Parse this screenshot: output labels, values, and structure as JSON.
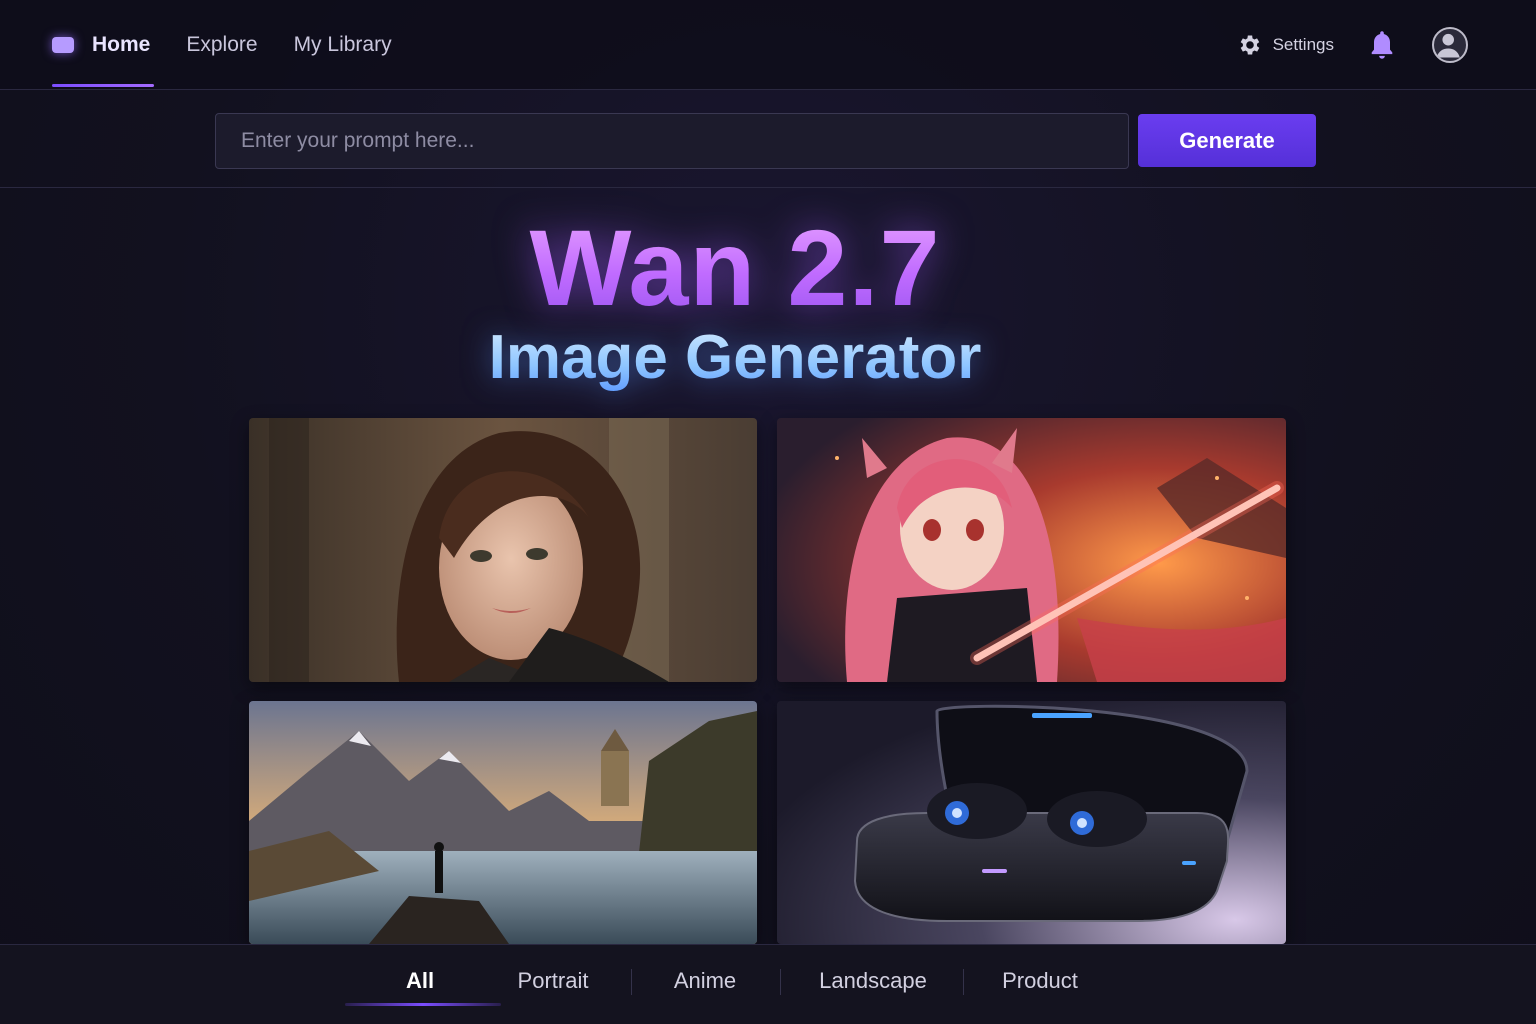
{
  "nav": {
    "items": [
      {
        "label": "Home",
        "active": true
      },
      {
        "label": "Explore",
        "active": false
      },
      {
        "label": "My Library",
        "active": false
      }
    ],
    "settings_label": "Settings",
    "icons": {
      "home": "home-icon",
      "settings": "gear-icon",
      "notifications": "bell-icon",
      "profile": "user-avatar-icon"
    }
  },
  "prompt": {
    "placeholder": "Enter your prompt here...",
    "value": "",
    "generate_label": "Generate"
  },
  "hero": {
    "title": "Wan 2.7",
    "subtitle": "Image Generator"
  },
  "gallery": [
    {
      "category": "Portrait",
      "subject": "woman portrait"
    },
    {
      "category": "Anime",
      "subject": "anime swordswoman"
    },
    {
      "category": "Landscape",
      "subject": "mountain lake castle"
    },
    {
      "category": "Product",
      "subject": "wireless earbuds case"
    }
  ],
  "tabs": [
    {
      "label": "All",
      "active": true
    },
    {
      "label": "Portrait",
      "active": false
    },
    {
      "label": "Anime",
      "active": false
    },
    {
      "label": "Landscape",
      "active": false
    },
    {
      "label": "Product",
      "active": false
    }
  ],
  "colors": {
    "background": "#12111f",
    "accent": "#6a3df0",
    "title_gradient": "#c06bff",
    "subtitle_gradient": "#8fc6ff"
  }
}
